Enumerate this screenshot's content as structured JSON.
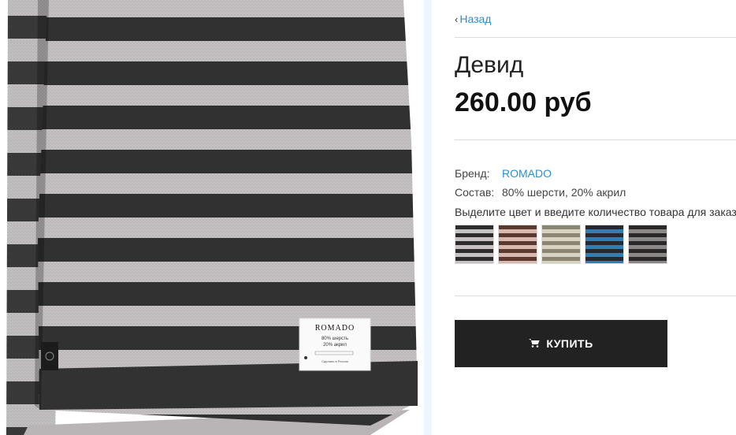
{
  "nav": {
    "back_label": "Назад"
  },
  "product": {
    "title": "Девид",
    "price": "260.00 руб",
    "brand_label": "Бренд:",
    "brand_value": "ROMADO",
    "composition_label": "Состав:",
    "composition_value": "80% шерсти, 20% акрил",
    "color_hint": "Выделите цвет и введите количество товара для заказа"
  },
  "image_label": {
    "brand": "ROMADO",
    "line1": "80% шерсть",
    "line2": "20% акрил",
    "line3": "Сделано в России"
  },
  "swatches": [
    {
      "name": "black-grey",
      "c1": "#2d2d2d",
      "c2": "#c6c2c4"
    },
    {
      "name": "brown-pink",
      "c1": "#5a3a30",
      "c2": "#d9b8ae"
    },
    {
      "name": "beige-grey",
      "c1": "#8d8573",
      "c2": "#d8d2c1"
    },
    {
      "name": "blue-black",
      "c1": "#252a30",
      "c2": "#2f7fb5"
    },
    {
      "name": "dark-grey",
      "c1": "#2a2828",
      "c2": "#8c8888"
    }
  ],
  "actions": {
    "buy_label": "КУПИТЬ"
  },
  "colors": {
    "accent": "#2a8fcf",
    "button": "#222222"
  }
}
